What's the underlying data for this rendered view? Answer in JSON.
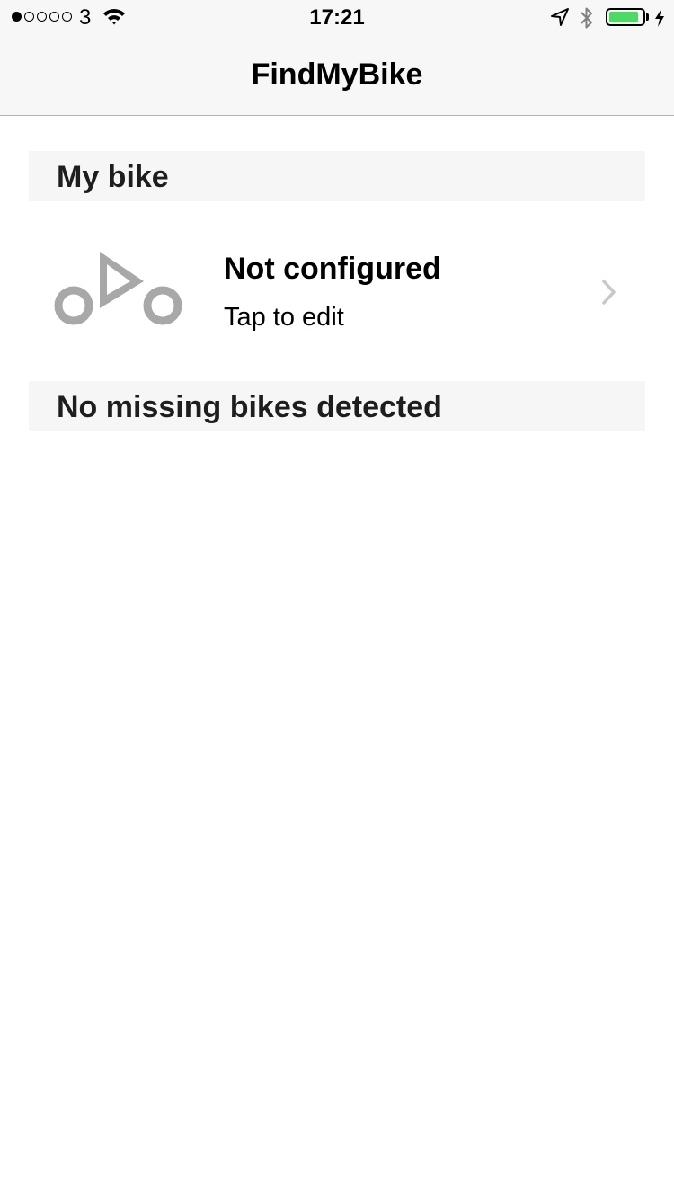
{
  "status_bar": {
    "carrier": "3",
    "time": "17:21",
    "signal_strength_dots_filled": 1,
    "signal_strength_dots_total": 5,
    "battery_level_fraction": 0.9,
    "battery_color": "#4cd964",
    "icons": [
      "wifi-icon",
      "location-arrow-icon",
      "bluetooth-icon",
      "battery-icon",
      "charging-bolt-icon"
    ]
  },
  "nav": {
    "title": "FindMyBike"
  },
  "my_bike_section": {
    "header": "My bike",
    "bike": {
      "icon": "bike-icon",
      "title": "Not configured",
      "subtitle": "Tap to edit",
      "accessory_icon": "chevron-right-icon"
    }
  },
  "missing_section": {
    "header": "No missing bikes detected"
  },
  "colors": {
    "bar_background": "#f7f7f7",
    "section_background": "#f6f6f6",
    "icon_gray": "#a8a8a8",
    "chevron_gray": "#c7c7cc"
  }
}
